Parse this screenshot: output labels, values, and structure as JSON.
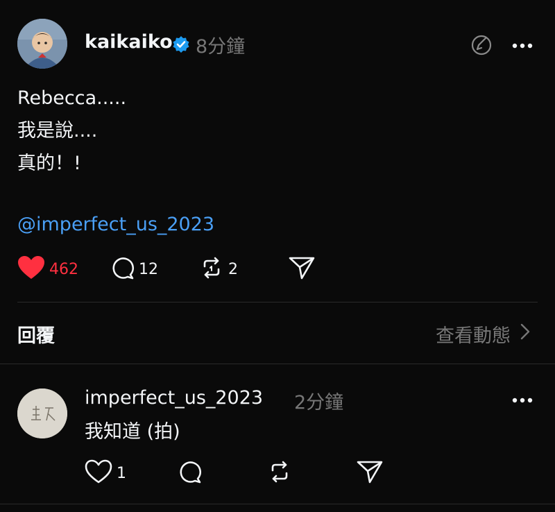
{
  "post": {
    "username": "kaikaiko",
    "time": "8分鐘",
    "lines": [
      "Rebecca.....",
      "我是說....",
      "真的！!"
    ],
    "mention": "@imperfect_us_2023",
    "likes": "462",
    "comments": "12",
    "reposts": "2"
  },
  "replies_section": {
    "label": "回覆",
    "view_activity": "查看動態"
  },
  "reply": {
    "username": "imperfect_us_2023",
    "time": "2分鐘",
    "text": "我知道 (拍)",
    "likes": "1"
  },
  "colors": {
    "background": "#0a0a0a",
    "like_active": "#ff3040",
    "mention": "#4a9ff5",
    "verified": "#1d9bf0"
  },
  "icons": [
    "verified-badge-icon",
    "edit-icon",
    "more-icon",
    "heart-icon",
    "comment-icon",
    "repost-icon",
    "share-icon",
    "chevron-right-icon"
  ]
}
